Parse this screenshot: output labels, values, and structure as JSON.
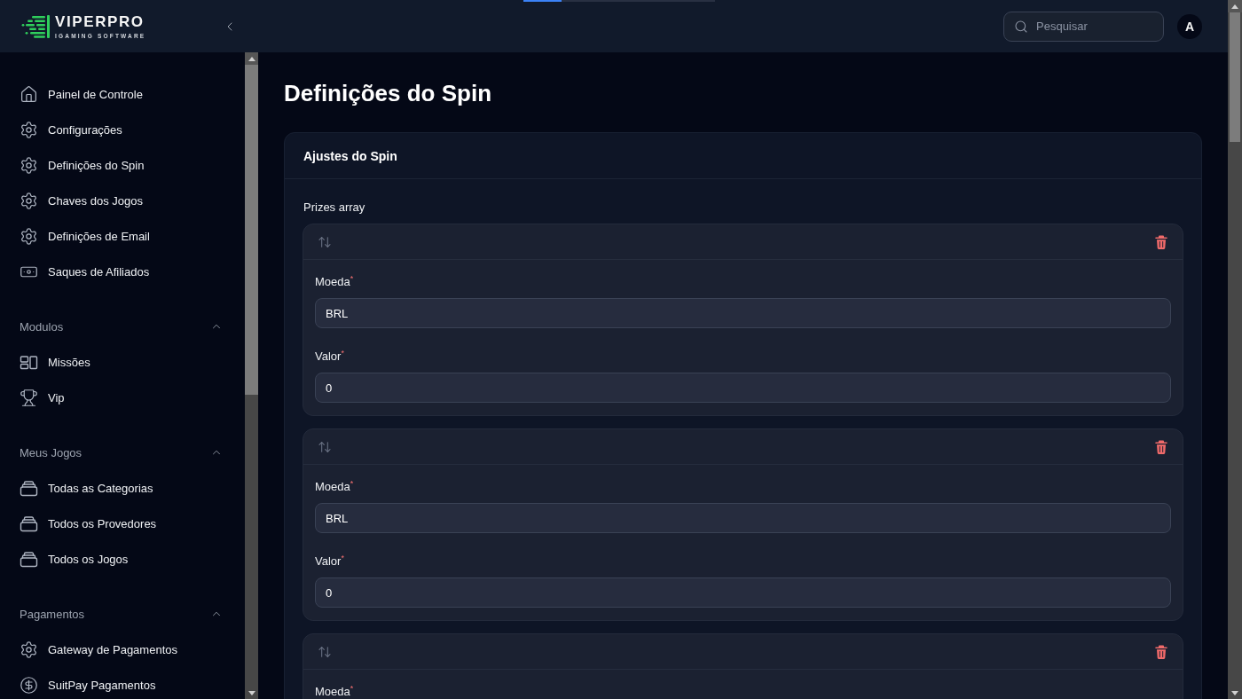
{
  "loading_bar": {
    "level": 0.2
  },
  "header": {
    "logo": {
      "title": "VIPERPRO",
      "tagline": "IGAMING SOFTWARE"
    },
    "search": {
      "placeholder": "Pesquisar"
    },
    "avatar": "A"
  },
  "sidebar": {
    "items": [
      "Painel de Controle",
      "Configurações",
      "Definições do Spin",
      "Chaves dos Jogos",
      "Definições de Email",
      "Saques de Afiliados"
    ],
    "sections": [
      {
        "title": "Modulos",
        "expanded": true,
        "items": [
          "Missões",
          "Vip"
        ]
      },
      {
        "title": "Meus Jogos",
        "expanded": true,
        "items": [
          "Todas as Categorias",
          "Todos os Provedores",
          "Todos os Jogos"
        ]
      },
      {
        "title": "Pagamentos",
        "expanded": true,
        "items": [
          "Gateway de Pagamentos",
          "SuitPay Pagamentos"
        ]
      }
    ]
  },
  "page": {
    "title": "Definições do Spin",
    "card": {
      "title": "Ajustes do Spin",
      "repeater": {
        "label": "Prizes array",
        "items": [
          {
            "fields": [
              {
                "label": "Moeda$^{*}$",
                "value": "BRL"
              },
              {
                "label": "Valor$^{*}$",
                "value": "0"
              }
            ]
          },
          {
            "fields": [
              {
                "label": "Moeda$^{*}$",
                "value": "BRL"
              },
              {
                "label": "Valor$^{*}$",
                "value": "0"
              }
            ]
          },
          {
            "fields": [
              {
                "label": "Moeda$^{*}$"
              }
            ]
          }
        ]
      }
    }
  }
}
